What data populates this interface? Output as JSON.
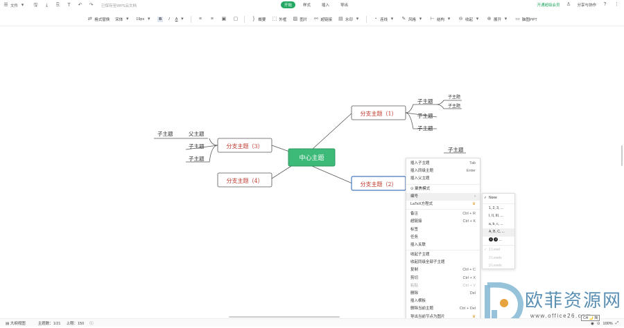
{
  "topbar": {
    "file_menu": "文件",
    "saved_text": "已保存至WPS云文档",
    "tabs": [
      {
        "label": "开始",
        "active": true
      },
      {
        "label": "样式",
        "active": false
      },
      {
        "label": "插入",
        "active": false
      },
      {
        "label": "导出",
        "active": false
      }
    ],
    "vip_label": "开通超级会员",
    "share_label": "分享与协作"
  },
  "toolbar": {
    "format_painter": "格式替换",
    "font": "宋体",
    "size": "19px",
    "bold": "B",
    "italic": "I",
    "font_color": "A",
    "summary": "概要",
    "boundary": "外框",
    "image": "图片",
    "hyperlink": "超链接",
    "watermark": "水印",
    "connect": "连线",
    "style": "风格",
    "structure": "结构",
    "collapse": "收起",
    "expand": "展开",
    "ppt": "脑图PPT"
  },
  "mindmap": {
    "center": "中心主题",
    "branch1": "分支主题（1）",
    "branch2": "分支主题（2）",
    "branch3": "分支主题（3）",
    "branch4": "分支主题（4）",
    "sub": "子主题",
    "parent": "父主题"
  },
  "context_menu": [
    {
      "label": "插入子主题",
      "shortcut": "Tab"
    },
    {
      "label": "插入同级主题",
      "shortcut": "Enter"
    },
    {
      "label": "插入父主题",
      "shortcut": ""
    },
    {
      "label": "聚焦模式",
      "shortcut": ""
    },
    {
      "label": "编号",
      "shortcut": ""
    },
    {
      "label": "LaTeX方程式",
      "shortcut": ""
    },
    {
      "label": "备注",
      "shortcut": "Ctrl + R"
    },
    {
      "label": "超链接",
      "shortcut": "Ctrl + K"
    },
    {
      "label": "标签",
      "shortcut": ""
    },
    {
      "label": "任务",
      "shortcut": ""
    },
    {
      "label": "插入关联",
      "shortcut": ""
    },
    {
      "label": "收起子主题",
      "shortcut": ""
    },
    {
      "label": "收起同级全部子主题",
      "shortcut": ""
    },
    {
      "label": "复制",
      "shortcut": "Ctrl + C"
    },
    {
      "label": "剪切",
      "shortcut": "Ctrl + X"
    },
    {
      "label": "粘贴",
      "shortcut": "Ctrl + V"
    },
    {
      "label": "删除",
      "shortcut": "Del"
    },
    {
      "label": "插入横板",
      "shortcut": ""
    },
    {
      "label": "删除当前主题",
      "shortcut": "Ctrl + Del"
    },
    {
      "label": "导出当前节点为图片",
      "shortcut": ""
    }
  ],
  "numbering_menu": [
    {
      "label": "None"
    },
    {
      "label": "1, 2, 3, ..."
    },
    {
      "label": "I, II, III, ..."
    },
    {
      "label": "a, b, c, ..."
    },
    {
      "label": "A, B, C, ..."
    },
    {
      "label": "..."
    },
    {
      "label": "1 Level"
    },
    {
      "label": "2 Levels"
    },
    {
      "label": "3 Levels"
    }
  ],
  "statusbar": {
    "outline": "大纲视图",
    "topic_count": "主题数：1/21",
    "level": "上限：150",
    "zoom": "100%",
    "ime": "CH 🌙 简"
  },
  "watermark": {
    "cn": "欧菲资源网",
    "en": "www.office26.com"
  },
  "colors": {
    "accent": "#22a862",
    "center_fill": "#3dba78",
    "branch_text": "#c0392b",
    "selected_border": "#4a78c2"
  }
}
